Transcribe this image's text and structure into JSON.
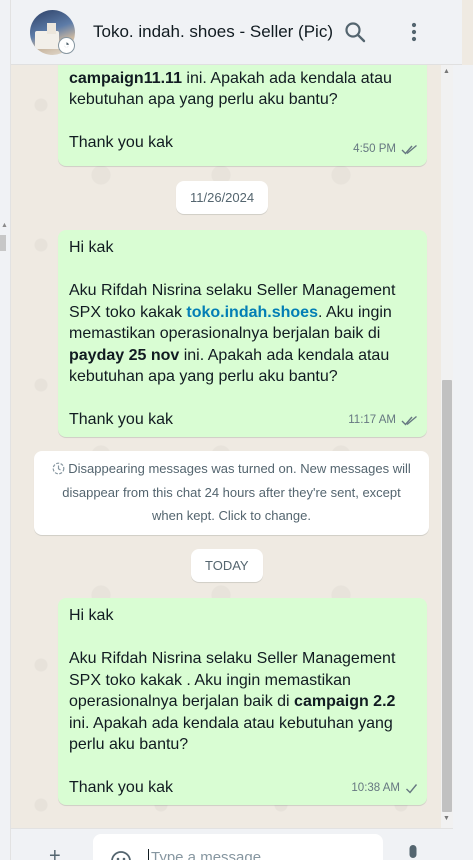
{
  "header": {
    "title": "Toko. indah. shoes - Seller (Pic)",
    "avatar_icon": "status-ring-icon",
    "search_icon": "search-icon",
    "menu_icon": "more-vertical-icon"
  },
  "messages": [
    {
      "line1_bold": "campaign11.11",
      "line1_rest": " ini. Apakah ada kendala atau",
      "line2": "kebutuhan apa yang perlu aku bantu?",
      "thanks": "Thank you kak",
      "time": "4:50 PM",
      "status": "read"
    },
    {
      "greeting": "Hi kak",
      "intro_part1": "Aku Rifdah Nisrina selaku Seller Management SPX toko kakak ",
      "shop_link": "toko.indah.shoes",
      "intro_part2": ". Aku ingin memastikan operasionalnya berjalan baik di ",
      "event_bold": "payday 25 nov",
      "intro_part3": " ini. Apakah ada kendala atau kebutuhan apa yang perlu aku bantu?",
      "thanks": "Thank you kak",
      "time": "11:17 AM",
      "status": "read"
    },
    {
      "greeting": "Hi kak",
      "intro_part1": "Aku Rifdah Nisrina selaku Seller Management SPX toko kakak . Aku ingin memastikan operasionalnya berjalan baik di ",
      "event_bold": "campaign 2.2",
      "intro_part2": " ini. Apakah ada kendala atau kebutuhan yang perlu aku bantu?",
      "thanks": "Thank you kak",
      "time": "10:38 AM",
      "status": "sent"
    }
  ],
  "date_chips": {
    "first": "11/26/2024",
    "second": "TODAY"
  },
  "system_message": {
    "text": "Disappearing messages was turned on. New messages will disappear from this chat 24 hours after they're sent, except when kept. Click to change.",
    "icon": "timer-icon"
  },
  "composer": {
    "placeholder": "Type a message",
    "plus_icon": "plus-icon",
    "emoji_icon": "emoji-icon",
    "mic_icon": "mic-icon"
  },
  "colors": {
    "outgoing_bubble": "#d9fdd3",
    "chat_background": "#efeae2",
    "link": "#027eb5",
    "read_tick": "#53bdeb",
    "panel": "#f0f2f5"
  }
}
